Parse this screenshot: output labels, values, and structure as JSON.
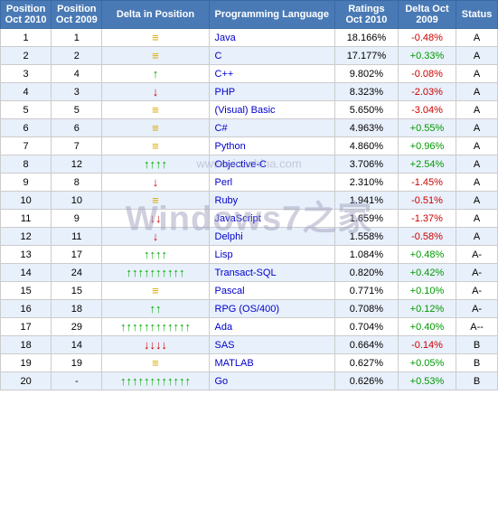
{
  "table": {
    "headers": [
      "Position Oct 2010",
      "Position Oct 2009",
      "Delta in Position",
      "Programming Language",
      "Ratings Oct 2010",
      "Delta Oct 2009",
      "Status"
    ],
    "rows": [
      {
        "pos2010": "1",
        "pos2009": "1",
        "delta": "eq",
        "lang": "Java",
        "rating": "18.166%",
        "delta_val": "-0.48%",
        "status": "A",
        "delta_dir": "neg"
      },
      {
        "pos2010": "2",
        "pos2009": "2",
        "delta": "eq",
        "lang": "C",
        "rating": "17.177%",
        "delta_val": "+0.33%",
        "status": "A",
        "delta_dir": "pos"
      },
      {
        "pos2010": "3",
        "pos2009": "4",
        "delta": "up1",
        "lang": "C++",
        "rating": "9.802%",
        "delta_val": "-0.08%",
        "status": "A",
        "delta_dir": "neg"
      },
      {
        "pos2010": "4",
        "pos2009": "3",
        "delta": "down1",
        "lang": "PHP",
        "rating": "8.323%",
        "delta_val": "-2.03%",
        "status": "A",
        "delta_dir": "neg"
      },
      {
        "pos2010": "5",
        "pos2009": "5",
        "delta": "eq",
        "lang": "(Visual) Basic",
        "rating": "5.650%",
        "delta_val": "-3.04%",
        "status": "A",
        "delta_dir": "neg"
      },
      {
        "pos2010": "6",
        "pos2009": "6",
        "delta": "eq",
        "lang": "C#",
        "rating": "4.963%",
        "delta_val": "+0.55%",
        "status": "A",
        "delta_dir": "pos"
      },
      {
        "pos2010": "7",
        "pos2009": "7",
        "delta": "eq",
        "lang": "Python",
        "rating": "4.860%",
        "delta_val": "+0.96%",
        "status": "A",
        "delta_dir": "pos"
      },
      {
        "pos2010": "8",
        "pos2009": "12",
        "delta": "up4",
        "lang": "Objective-C",
        "rating": "3.706%",
        "delta_val": "+2.54%",
        "status": "A",
        "delta_dir": "pos"
      },
      {
        "pos2010": "9",
        "pos2009": "8",
        "delta": "down1",
        "lang": "Perl",
        "rating": "2.310%",
        "delta_val": "-1.45%",
        "status": "A",
        "delta_dir": "neg"
      },
      {
        "pos2010": "10",
        "pos2009": "10",
        "delta": "eq",
        "lang": "Ruby",
        "rating": "1.941%",
        "delta_val": "-0.51%",
        "status": "A",
        "delta_dir": "neg"
      },
      {
        "pos2010": "11",
        "pos2009": "9",
        "delta": "down2",
        "lang": "JavaScript",
        "rating": "1.659%",
        "delta_val": "-1.37%",
        "status": "A",
        "delta_dir": "neg"
      },
      {
        "pos2010": "12",
        "pos2009": "11",
        "delta": "down1",
        "lang": "Delphi",
        "rating": "1.558%",
        "delta_val": "-0.58%",
        "status": "A",
        "delta_dir": "neg"
      },
      {
        "pos2010": "13",
        "pos2009": "17",
        "delta": "up4",
        "lang": "Lisp",
        "rating": "1.084%",
        "delta_val": "+0.48%",
        "status": "A-",
        "delta_dir": "pos"
      },
      {
        "pos2010": "14",
        "pos2009": "24",
        "delta": "up10",
        "lang": "Transact-SQL",
        "rating": "0.820%",
        "delta_val": "+0.42%",
        "status": "A-",
        "delta_dir": "pos"
      },
      {
        "pos2010": "15",
        "pos2009": "15",
        "delta": "eq",
        "lang": "Pascal",
        "rating": "0.771%",
        "delta_val": "+0.10%",
        "status": "A-",
        "delta_dir": "pos"
      },
      {
        "pos2010": "16",
        "pos2009": "18",
        "delta": "up2",
        "lang": "RPG (OS/400)",
        "rating": "0.708%",
        "delta_val": "+0.12%",
        "status": "A-",
        "delta_dir": "pos"
      },
      {
        "pos2010": "17",
        "pos2009": "29",
        "delta": "up12",
        "lang": "Ada",
        "rating": "0.704%",
        "delta_val": "+0.40%",
        "status": "A--",
        "delta_dir": "pos"
      },
      {
        "pos2010": "18",
        "pos2009": "14",
        "delta": "down4r",
        "lang": "SAS",
        "rating": "0.664%",
        "delta_val": "-0.14%",
        "status": "B",
        "delta_dir": "neg"
      },
      {
        "pos2010": "19",
        "pos2009": "19",
        "delta": "eq",
        "lang": "MATLAB",
        "rating": "0.627%",
        "delta_val": "+0.05%",
        "status": "B",
        "delta_dir": "pos"
      },
      {
        "pos2010": "20",
        "pos2009": "-",
        "delta": "up_big",
        "lang": "Go",
        "rating": "0.626%",
        "delta_val": "+0.53%",
        "status": "B",
        "delta_dir": "pos"
      }
    ]
  },
  "watermark": "Windows7之家",
  "watermark2": "www.winzchina.com"
}
